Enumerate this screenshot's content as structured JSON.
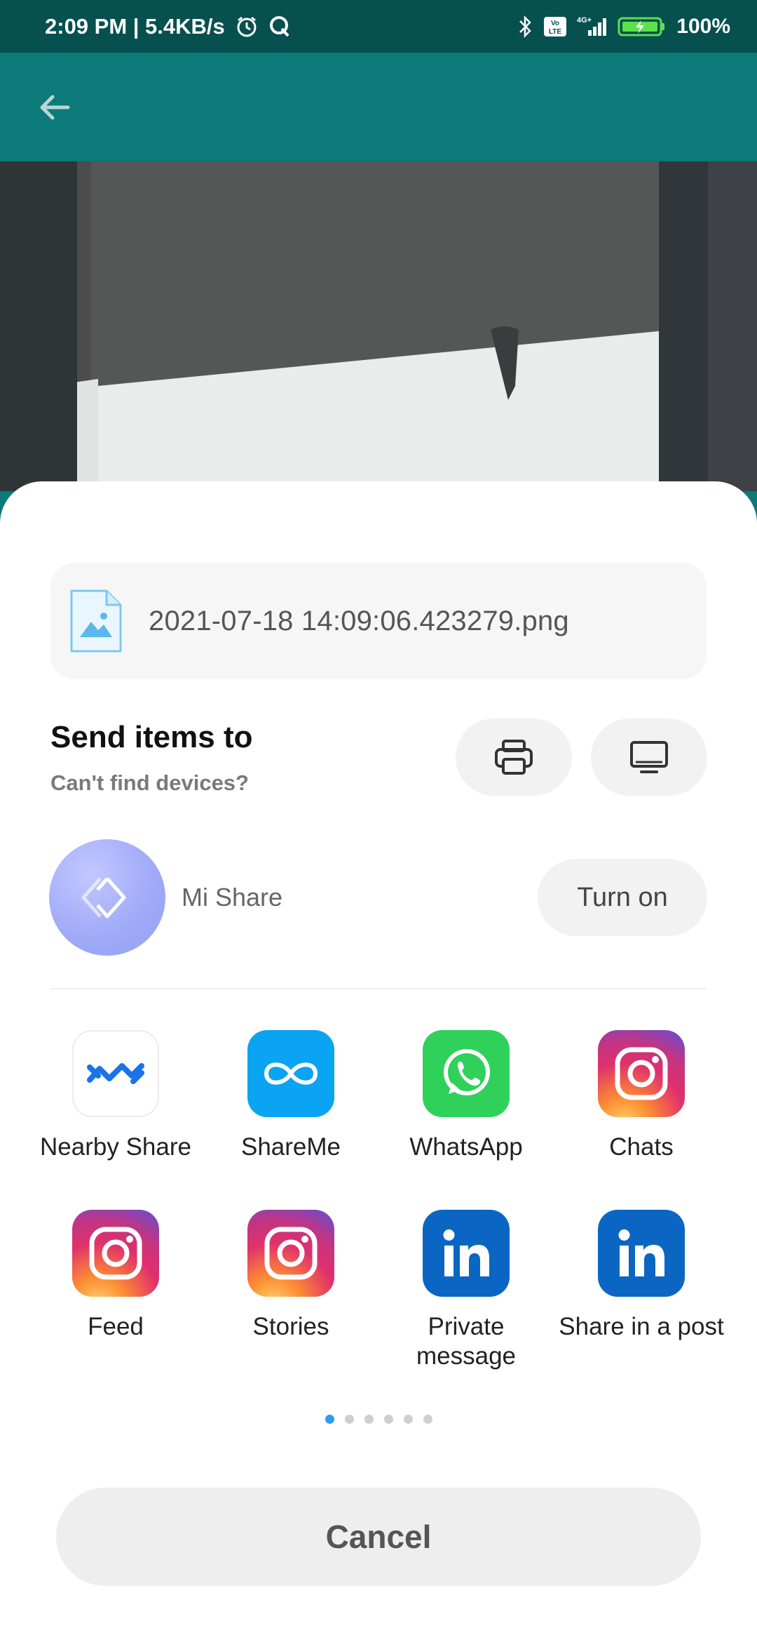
{
  "status_bar": {
    "time_speed": "2:09 PM | 5.4KB/s",
    "network_label": "4G+",
    "volte_label": "Vo LTE",
    "battery_percent": "100%"
  },
  "file": {
    "name": "2021-07-18 14:09:06.423279.png"
  },
  "send": {
    "title": "Send items to",
    "subtitle": "Can't find devices?"
  },
  "mi_share": {
    "label": "Mi Share",
    "button_label": "Turn on"
  },
  "apps": [
    {
      "label": "Nearby Share",
      "icon": "nearby-share-icon"
    },
    {
      "label": "ShareMe",
      "icon": "shareme-icon"
    },
    {
      "label": "WhatsApp",
      "icon": "whatsapp-icon"
    },
    {
      "label": "Chats",
      "icon": "instagram-icon"
    },
    {
      "label": "Feed",
      "icon": "instagram-icon"
    },
    {
      "label": "Stories",
      "icon": "instagram-icon"
    },
    {
      "label": "Private message",
      "icon": "linkedin-icon"
    },
    {
      "label": "Share in a post",
      "icon": "linkedin-icon"
    }
  ],
  "pager": {
    "pages": 6,
    "active": 1
  },
  "cancel_label": "Cancel",
  "colors": {
    "app_bar": "#0b7a78",
    "status_bar": "#06504f",
    "accent_dot": "#2c9cf0",
    "whatsapp": "#2fd15a",
    "shareme": "#0aa4f2",
    "linkedin": "#0a66c2"
  }
}
